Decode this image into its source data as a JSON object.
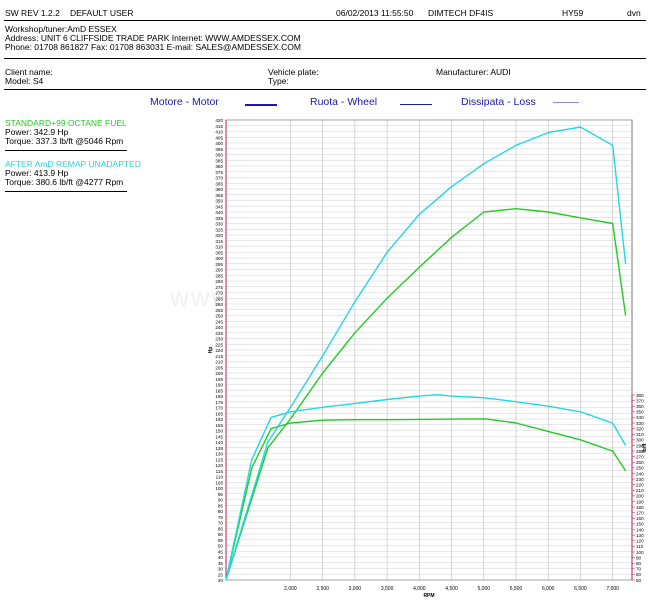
{
  "header": {
    "software": "SW REV 1.2.2",
    "user": "DEFAULT USER",
    "datetime": "06/02/2013 11:55:50",
    "dyno": "DIMTECH DF4IS",
    "code": "HY59",
    "suffix": "dvn"
  },
  "workshop": {
    "line1": "Workshop/tuner:AmD ESSEX",
    "line2": "Address: UNIT 6 CLIFFSIDE TRADE PARK Internet: WWW.AMDESSEX.COM",
    "line3": "Phone: 01708 861827 Fax: 01708 863031 E-mail: SALES@AMDESSEX.COM"
  },
  "vehicle": {
    "client_label": "Client name:",
    "model_label": "Model: S4",
    "plate_label": "Vehicle plate:",
    "type_label": "Type:",
    "manufacturer_label": "Manufacturer: AUDI"
  },
  "legend": {
    "motor": "Motore - Motor",
    "wheel": "Ruota - Wheel",
    "loss": "Dissipata - Loss",
    "swatch_color": "#1a1aa6",
    "loss_color": "#8a8ae0"
  },
  "runs": [
    {
      "title": "STANDARD+99 OCTANE FUEL",
      "power": "Power: 342.9 Hp",
      "torque": "Torque: 337.3 lb/ft @5046 Rpm",
      "color": "#22cc22"
    },
    {
      "title": "AFTER AmD REMAP UNADAPTED",
      "power": "Power: 413.9 Hp",
      "torque": "Torque: 380.6 lb/ft @4277 Rpm",
      "color": "#22d7e6"
    }
  ],
  "watermark": "www.AmDtuning.com",
  "chart_data": {
    "type": "line",
    "xlabel": "RPM",
    "ylabel_left": "Hp",
    "ylabel_right": "lb/ft",
    "xlim": [
      1000,
      7300
    ],
    "ylim_left": [
      20,
      420
    ],
    "ylim_right": [
      50,
      380
    ],
    "x_ticks": [
      "2,000",
      "2,500",
      "3,000",
      "3,500",
      "4,000",
      "4,500",
      "5,000",
      "5,500",
      "6,000",
      "6,500",
      "7,000"
    ],
    "grid": true,
    "series": [
      {
        "name": "STANDARD+99 OCTANE FUEL",
        "kind": "power",
        "color": "#22cc22",
        "x": [
          1000,
          1650,
          2000,
          2500,
          3000,
          3500,
          4000,
          4500,
          5000,
          5500,
          6000,
          6500,
          7000,
          7200
        ],
        "y": [
          20,
          135,
          160,
          200,
          235,
          265,
          292,
          318,
          340,
          342.9,
          340,
          335,
          330,
          250
        ]
      },
      {
        "name": "STANDARD+99 OCTANE FUEL",
        "kind": "torque",
        "color": "#22cc22",
        "x": [
          1000,
          1400,
          1700,
          2000,
          2500,
          3000,
          3500,
          4000,
          4500,
          5046,
          5500,
          6000,
          6500,
          7000,
          7200
        ],
        "y": [
          50,
          250,
          320,
          330,
          335,
          336,
          336,
          336.5,
          337,
          337.3,
          330,
          315,
          300,
          280,
          245
        ]
      },
      {
        "name": "AFTER AmD REMAP UNADAPTED",
        "kind": "power",
        "color": "#22d7e6",
        "x": [
          1000,
          1650,
          2000,
          2500,
          3000,
          3500,
          4000,
          4500,
          5000,
          5500,
          6000,
          6500,
          7000,
          7200
        ],
        "y": [
          20,
          140,
          170,
          215,
          262,
          305,
          338,
          362,
          382,
          398,
          409,
          413.9,
          398,
          295
        ]
      },
      {
        "name": "AFTER AmD REMAP UNADAPTED",
        "kind": "torque",
        "color": "#22d7e6",
        "x": [
          1000,
          1400,
          1700,
          2000,
          2500,
          3000,
          3500,
          4000,
          4277,
          4500,
          5000,
          5500,
          6000,
          6500,
          7000,
          7200
        ],
        "y": [
          50,
          265,
          340,
          350,
          358,
          365,
          372,
          378,
          380.6,
          378,
          375,
          368,
          360,
          350,
          330,
          290
        ]
      }
    ]
  }
}
